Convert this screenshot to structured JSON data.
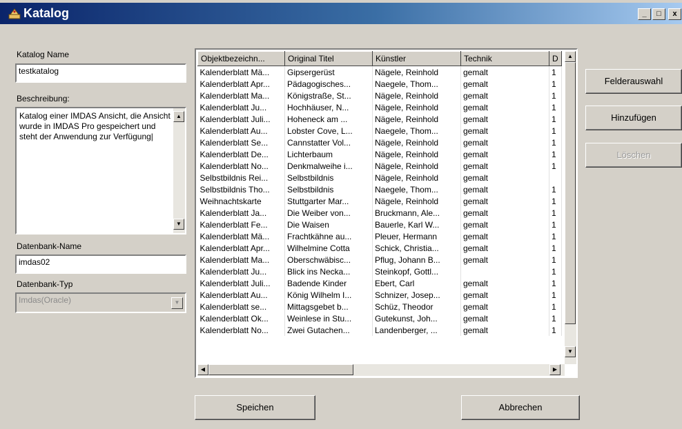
{
  "window": {
    "title": "Katalog",
    "minimize": "_",
    "maximize": "□",
    "close": "x"
  },
  "form": {
    "catalog_name_label": "Katalog Name",
    "catalog_name_value": "testkatalog",
    "description_label": "Beschreibung:",
    "description_value": "Katalog einer IMDAS Ansicht, die Ansicht wurde in IMDAS Pro gespeichert und steht der Anwendung zur Verfügung|",
    "db_name_label": "Datenbank-Name",
    "db_name_value": "imdas02",
    "db_type_label": "Datenbank-Typ",
    "db_type_value": "Imdas(Oracle)"
  },
  "grid": {
    "columns": [
      "Objektbezeichn...",
      "Original Titel",
      "Künstler",
      "Technik",
      "D"
    ],
    "rows": [
      [
        "Kalenderblatt Mä...",
        "Gipsergerüst",
        "Nägele, Reinhold",
        "gemalt",
        "1"
      ],
      [
        "Kalenderblatt Apr...",
        "Pädagogisches...",
        "Naegele, Thom...",
        "gemalt",
        "1"
      ],
      [
        "Kalenderblatt Ma...",
        "Königstraße, St...",
        "Nägele, Reinhold",
        "gemalt",
        "1"
      ],
      [
        "Kalenderblatt Ju...",
        "Hochhäuser, N...",
        "Nägele, Reinhold",
        "gemalt",
        "1"
      ],
      [
        "Kalenderblatt Juli...",
        "Hoheneck am ...",
        "Nägele, Reinhold",
        "gemalt",
        "1"
      ],
      [
        "Kalenderblatt Au...",
        "Lobster Cove, L...",
        "Naegele, Thom...",
        "gemalt",
        "1"
      ],
      [
        "Kalenderblatt Se...",
        "Cannstatter Vol...",
        "Nägele, Reinhold",
        "gemalt",
        "1"
      ],
      [
        "Kalenderblatt De...",
        "Lichterbaum",
        "Nägele, Reinhold",
        "gemalt",
        "1"
      ],
      [
        "Kalenderblatt No...",
        "Denkmalweihe i...",
        "Nägele, Reinhold",
        "gemalt",
        "1"
      ],
      [
        "Selbstbildnis Rei...",
        "Selbstbildnis",
        "Nägele, Reinhold",
        "gemalt",
        ""
      ],
      [
        "Selbstbildnis Tho...",
        "Selbstbildnis",
        "Naegele, Thom...",
        "gemalt",
        "1"
      ],
      [
        "Weihnachtskarte",
        "Stuttgarter Mar...",
        "Nägele, Reinhold",
        "gemalt",
        "1"
      ],
      [
        "Kalenderblatt Ja...",
        "Die Weiber von...",
        "Bruckmann, Ale...",
        "gemalt",
        "1"
      ],
      [
        "Kalenderblatt Fe...",
        "Die Waisen",
        "Bauerle, Karl W...",
        "gemalt",
        "1"
      ],
      [
        "Kalenderblatt Mä...",
        "Frachtkähne au...",
        "Pleuer, Hermann",
        "gemalt",
        "1"
      ],
      [
        "Kalenderblatt Apr...",
        "Wilhelmine Cotta",
        "Schick, Christia...",
        "gemalt",
        "1"
      ],
      [
        "Kalenderblatt Ma...",
        "Oberschwäbisc...",
        "Pflug, Johann B...",
        "gemalt",
        "1"
      ],
      [
        "Kalenderblatt Ju...",
        "Blick ins Necka...",
        "Steinkopf, Gottl...",
        "",
        "1"
      ],
      [
        "Kalenderblatt Juli...",
        "Badende Kinder",
        "Ebert, Carl",
        "gemalt",
        "1"
      ],
      [
        "Kalenderblatt Au...",
        "König Wilhelm I...",
        "Schnizer, Josep...",
        "gemalt",
        "1"
      ],
      [
        "Kalenderblatt se...",
        "Mittagsgebet b...",
        "Schüz, Theodor",
        "gemalt",
        "1"
      ],
      [
        "Kalenderblatt Ok...",
        "Weinlese in Stu...",
        "Gutekunst, Joh...",
        "gemalt",
        "1"
      ],
      [
        "Kalenderblatt No...",
        "Zwei Gutachen...",
        "Landenberger, ...",
        "gemalt",
        "1"
      ]
    ]
  },
  "buttons": {
    "field_select": "Felderauswahl",
    "add": "Hinzufügen",
    "delete": "Löschen",
    "save": "Speichen",
    "cancel": "Abbrechen"
  },
  "icons": {
    "app": "katalog-app-icon",
    "scroll_up": "▲",
    "scroll_down": "▼",
    "scroll_left": "◀",
    "scroll_right": "▶"
  }
}
